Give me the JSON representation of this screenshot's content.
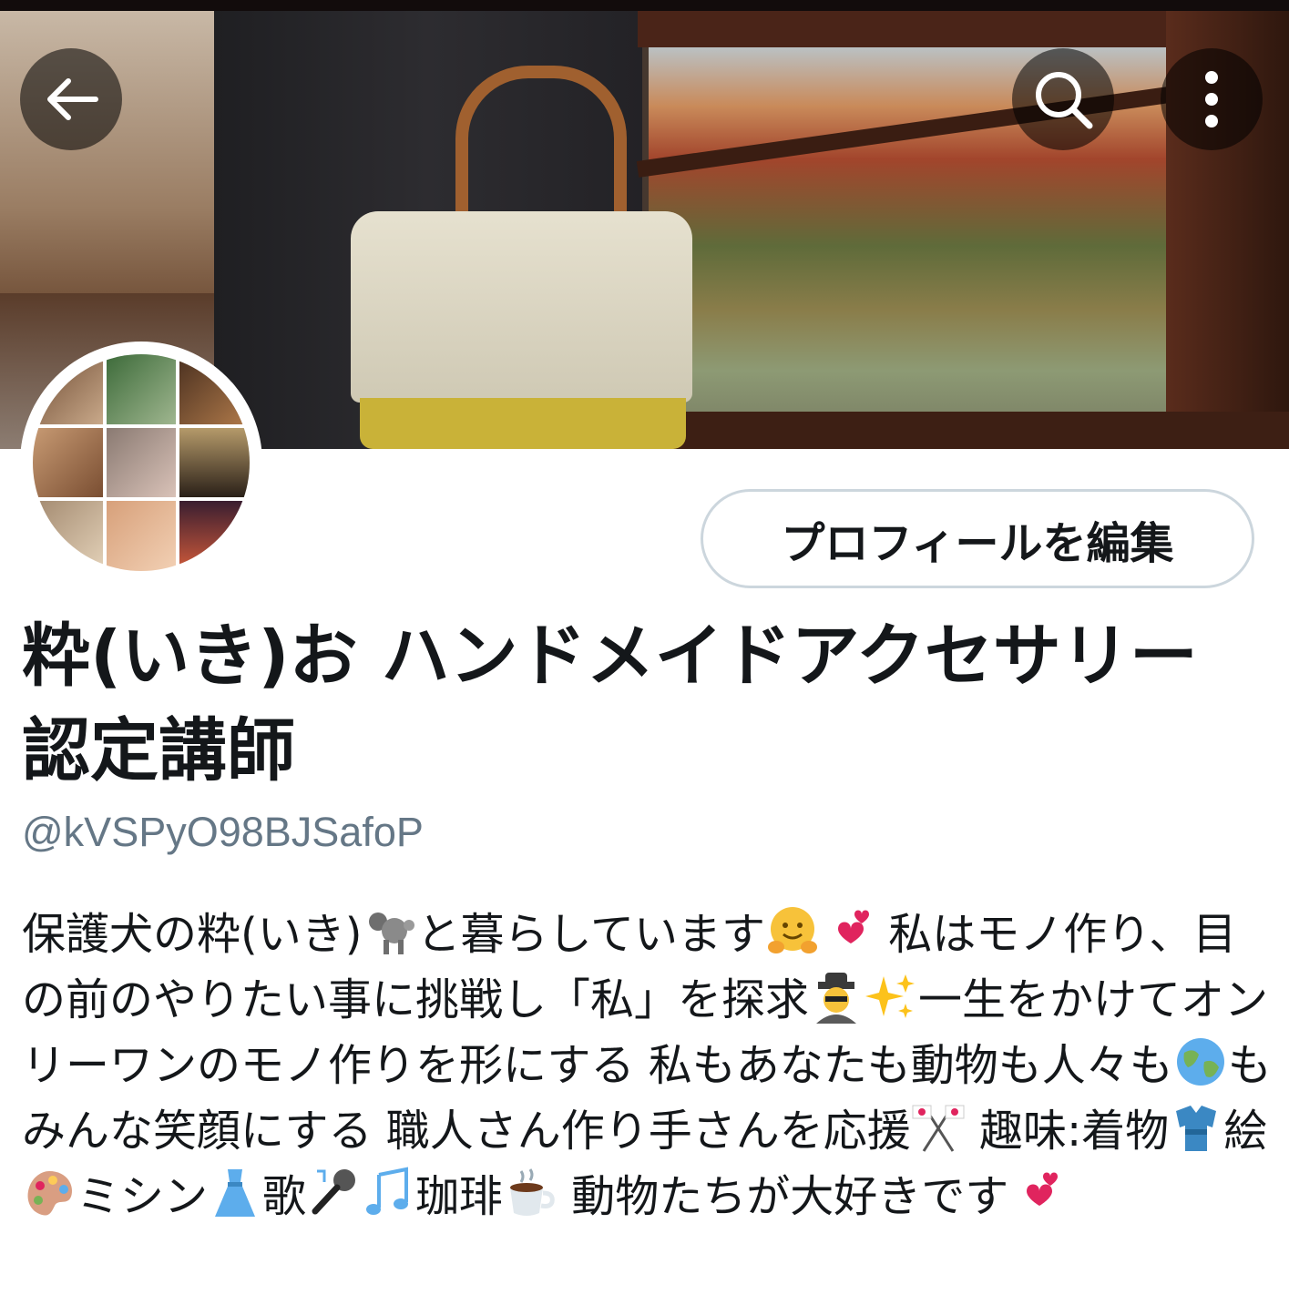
{
  "nav": {
    "back_icon": "arrow-left-icon",
    "search_icon": "search-icon",
    "more_icon": "more-vertical-icon"
  },
  "profile": {
    "edit_button_label": "プロフィールを編集",
    "display_name": "粋(いき)お ハンドメイドアクセサリー認定講師",
    "handle": "@kVSPyO98BJSafoP",
    "bio": [
      {
        "t": "保護犬の粋(いき)"
      },
      {
        "emoji": "poodle-icon"
      },
      {
        "t": "と暮らしています"
      },
      {
        "emoji": "hugging-face-icon"
      },
      {
        "emoji": "two-hearts-icon"
      },
      {
        "t": "  私はモノ作り、目の前のやりたい事に挑戦し「私」を探求"
      },
      {
        "emoji": "detective-icon"
      },
      {
        "emoji": "sparkles-icon"
      },
      {
        "t": "一生をかけてオンリーワンのモノ作りを形にする 私もあなたも動物も人々も"
      },
      {
        "emoji": "globe-icon"
      },
      {
        "t": "もみんな笑顔にする  職人さん作り手さんを応援"
      },
      {
        "emoji": "crossed-flags-icon"
      },
      {
        "t": "  趣味:着物"
      },
      {
        "emoji": "kimono-icon"
      },
      {
        "t": "絵"
      },
      {
        "emoji": "palette-icon"
      },
      {
        "t": "ミシン"
      },
      {
        "emoji": "dress-icon"
      },
      {
        "t": "歌"
      },
      {
        "emoji": "microphone-icon"
      },
      {
        "emoji": "music-notes-icon"
      },
      {
        "t": "珈琲"
      },
      {
        "emoji": "coffee-icon"
      },
      {
        "t": " 動物たちが大好きです"
      },
      {
        "emoji": "two-hearts-icon"
      }
    ]
  },
  "colors": {
    "handle_gray": "#657786",
    "button_border": "#ccd6dd",
    "text": "#14171a"
  }
}
